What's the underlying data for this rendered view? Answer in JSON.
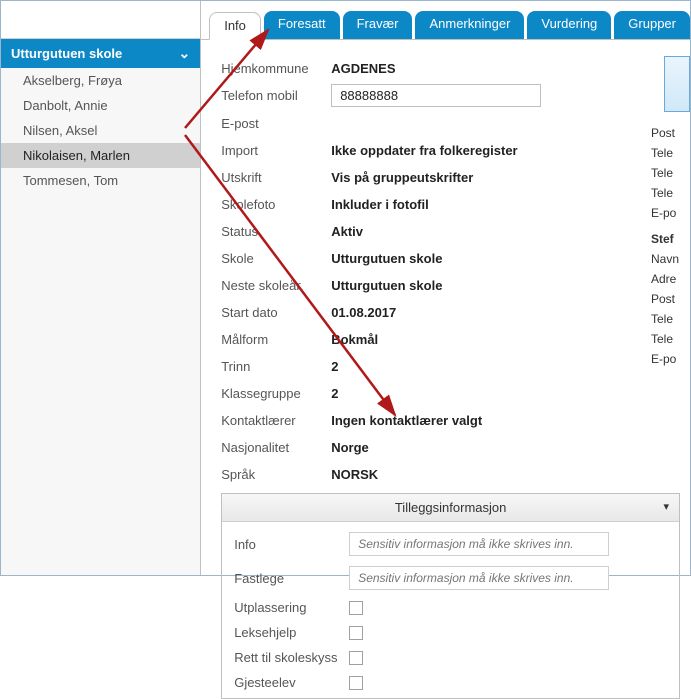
{
  "sidebar": {
    "school": "Utturgutuen skole",
    "students": [
      {
        "name": "Akselberg, Frøya"
      },
      {
        "name": "Danbolt, Annie"
      },
      {
        "name": "Nilsen, Aksel"
      },
      {
        "name": "Nikolaisen, Marlen"
      },
      {
        "name": "Tommesen, Tom"
      }
    ]
  },
  "tabs": [
    {
      "label": "Info"
    },
    {
      "label": "Foresatt"
    },
    {
      "label": "Fravær"
    },
    {
      "label": "Anmerkninger"
    },
    {
      "label": "Vurdering"
    },
    {
      "label": "Grupper"
    }
  ],
  "fields": {
    "hjemkommune_label": "Hjemkommune",
    "hjemkommune_value": "AGDENES",
    "telefonmobil_label": "Telefon mobil",
    "telefonmobil_value": "88888888",
    "epost_label": "E-post",
    "import_label": "Import",
    "import_value": "Ikke oppdater fra folkeregister",
    "utskrift_label": "Utskrift",
    "utskrift_value": "Vis på gruppeutskrifter",
    "skolefoto_label": "Skolefoto",
    "skolefoto_value": "Inkluder i fotofil",
    "status_label": "Status",
    "status_value": "Aktiv",
    "skole_label": "Skole",
    "skole_value": "Utturgutuen skole",
    "nesteskoleaar_label": "Neste skoleår",
    "nesteskoleaar_value": "Utturgutuen skole",
    "startdato_label": "Start dato",
    "startdato_value": "01.08.2017",
    "maalform_label": "Målform",
    "maalform_value": "Bokmål",
    "trinn_label": "Trinn",
    "trinn_value": "2",
    "klassegruppe_label": "Klassegruppe",
    "klassegruppe_value": "2",
    "kontaktlaerer_label": "Kontaktlærer",
    "kontaktlaerer_value": "Ingen kontaktlærer valgt",
    "nasjonalitet_label": "Nasjonalitet",
    "nasjonalitet_value": "Norge",
    "spraak_label": "Språk",
    "spraak_value": "NORSK"
  },
  "rightcol": {
    "post": "Post",
    "tele1": "Tele",
    "tele2": "Tele",
    "tele3": "Tele",
    "epo1": "E-po",
    "stef": "Stef",
    "navn": "Navn",
    "adre": "Adre",
    "post2": "Post",
    "tele4": "Tele",
    "tele5": "Tele",
    "epo2": "E-po"
  },
  "accordion": {
    "title": "Tilleggsinformasjon",
    "info_label": "Info",
    "info_placeholder": "Sensitiv informasjon må ikke skrives inn.",
    "fastlege_label": "Fastlege",
    "fastlege_placeholder": "Sensitiv informasjon må ikke skrives inn.",
    "utplassering_label": "Utplassering",
    "leksehjelp_label": "Leksehjelp",
    "rettskoleskyss_label": "Rett til skoleskyss",
    "gjesteelev_label": "Gjesteelev"
  }
}
